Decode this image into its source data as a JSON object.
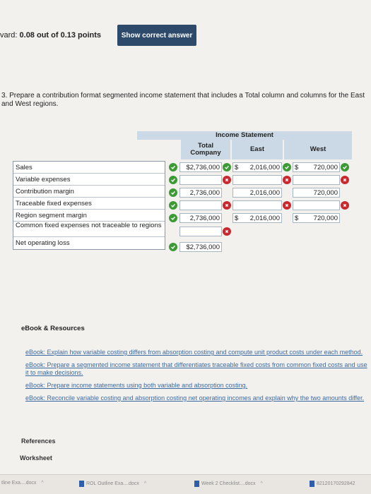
{
  "award": {
    "prefix": "vard: ",
    "score": "0.08 out of 0.13 points"
  },
  "show_answer_button": "Show correct answer",
  "question": "3. Prepare a contribution format segmented income statement that includes a Total column and columns for the East and West regions.",
  "table": {
    "title": "Income Statement",
    "headers": {
      "total_line1": "Total",
      "total_line2": "Company",
      "east": "East",
      "west": "West"
    },
    "rows": [
      {
        "label": "Sales",
        "total": "$2,736,000",
        "east": "2,016,000",
        "west": "720,000",
        "east_dollar": "$",
        "west_dollar": "$"
      },
      {
        "label": "Variable expenses",
        "total": "",
        "east": "",
        "west": ""
      },
      {
        "label": "Contribution margin",
        "total": "2,736,000",
        "east": "2,016,000",
        "west": "720,000"
      },
      {
        "label": "Traceable fixed expenses",
        "total": "",
        "east": "",
        "west": ""
      },
      {
        "label": "Region segment margin",
        "total": "2,736,000",
        "east": "2,016,000",
        "west": "720,000",
        "east_dollar": "$",
        "west_dollar": "$"
      },
      {
        "label": "Common fixed expenses not traceable to regions",
        "total": ""
      },
      {
        "label": "Net operating loss",
        "total": "$2,736,000"
      }
    ]
  },
  "ebook": {
    "title": "eBook & Resources",
    "links": [
      "eBook: Explain how variable costing differs from absorption costing and compute unit product costs under each method.",
      "eBook: Prepare a segmented income statement that differentiates traceable fixed costs from common fixed costs and use it to make decisions.",
      "eBook: Prepare income statements using both variable and absorption costing.",
      "eBook: Reconcile variable costing and absorption costing net operating incomes and explain why the two amounts differ."
    ]
  },
  "references": "References",
  "worksheet": "Worksheet",
  "taskbar": {
    "items": [
      "tline Exa....docx",
      "ROL Outline Exa....docx",
      "Week 2 Checklist....docx",
      "82120170292842"
    ]
  },
  "colors": {
    "check": "#3c9a35",
    "cross": "#c8282e",
    "button": "#2d4a6b",
    "header": "#cbd9e6",
    "link": "#3b6aa3"
  }
}
